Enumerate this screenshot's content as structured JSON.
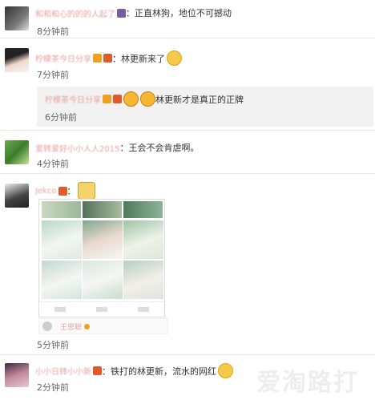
{
  "comments": [
    {
      "username": "和和和心的的的人起了",
      "badge_color": "#7a5aa0",
      "text": "：正直林狗，地位不可撼动",
      "time": "8分钟前"
    },
    {
      "username": "柠檬茶今日分享",
      "badge_color": "#e05a2a",
      "text": "：林更新来了",
      "time": "7分钟前"
    },
    {
      "username": "柠檬茶今日分享",
      "badge_color": "#e05a2a",
      "text": "林更新才是真正的正牌",
      "time": "6分钟前"
    },
    {
      "username": "爱转爱好小小人人2015",
      "badge_color": "",
      "text": "：王会不会肯虐啊。",
      "time": "4分钟前"
    },
    {
      "username": "Jekco",
      "badge_color": "#e05a2a",
      "text": "：",
      "time": "5分钟前",
      "card_name": "王思聪"
    },
    {
      "username": "小小日转小小新",
      "badge_color": "#e05a2a",
      "text": "：铁打的林更新，流水的网红",
      "time": "2分钟前"
    }
  ],
  "watermark": "爱淘路打",
  "colors": {
    "divider": "#e6e6e6",
    "reply_bg": "#f2f2f2",
    "time": "#666666"
  },
  "icons": [
    "smirk-emoji-icon",
    "laugh-emoji-icon",
    "cat-emoji-icon",
    "thumbs-emoji-icon"
  ]
}
